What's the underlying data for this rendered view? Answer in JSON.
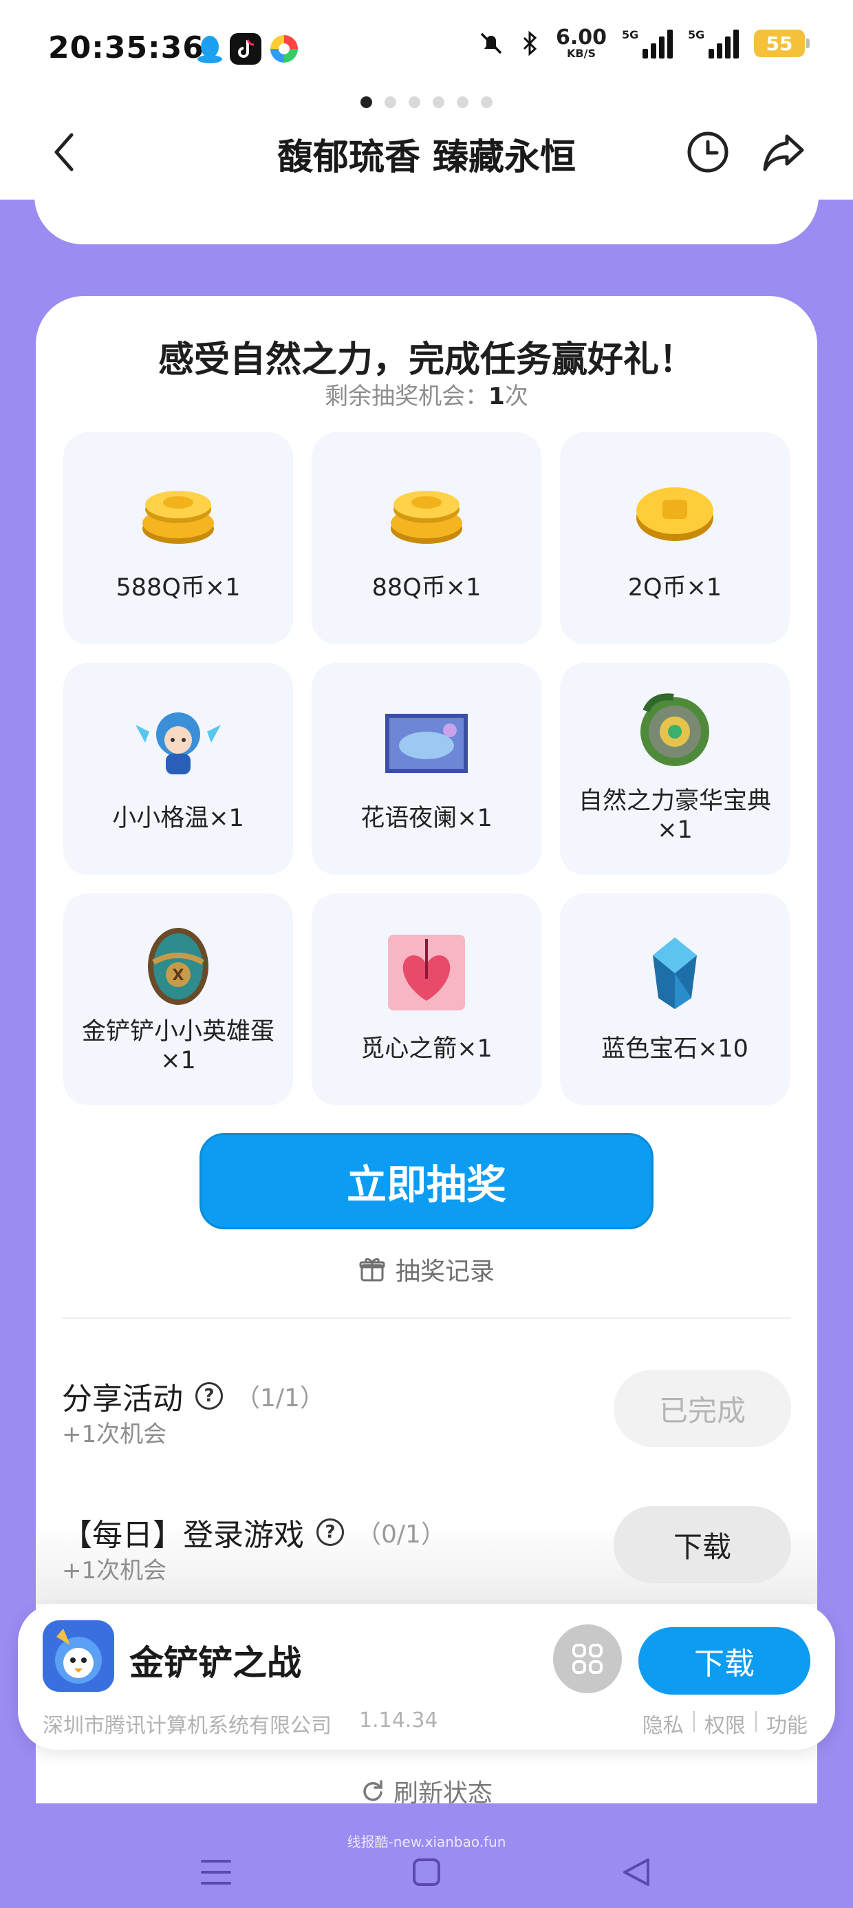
{
  "status_bar": {
    "time": "20:35:36",
    "net_speed_value": "6.00",
    "net_speed_unit": "KB/S",
    "sim1_label": "5G",
    "sim2_label": "5G",
    "battery": "55",
    "icons": [
      "qq-icon",
      "douyin-icon",
      "browser-icon",
      "mute-icon",
      "bluetooth-icon"
    ]
  },
  "header": {
    "title": "馥郁琉香 臻藏永恒",
    "icons": [
      "back-icon",
      "history-icon",
      "share-icon"
    ]
  },
  "carousel": {
    "count": 6,
    "active": 0
  },
  "promo": {
    "title": "感受自然之力，完成任务赢好礼！",
    "chances_label": "剩余抽奖机会：",
    "chances_value": "1",
    "chances_unit": "次"
  },
  "prizes": [
    {
      "name": "588Q币×1",
      "icon": "coin-stack-icon"
    },
    {
      "name": "88Q币×1",
      "icon": "coin-stack-icon"
    },
    {
      "name": "2Q币×1",
      "icon": "coin-icon"
    },
    {
      "name": "小小格温×1",
      "icon": "character-icon"
    },
    {
      "name": "花语夜阑×1",
      "icon": "arena-icon"
    },
    {
      "name": "自然之力豪华宝典×1",
      "icon": "pass-icon"
    },
    {
      "name": "金铲铲小小英雄蛋×1",
      "icon": "egg-icon"
    },
    {
      "name": "觅心之箭×1",
      "icon": "heart-arrow-icon"
    },
    {
      "name": "蓝色宝石×10",
      "icon": "gem-icon"
    }
  ],
  "draw_button": "立即抽奖",
  "record_link": "抽奖记录",
  "tasks": [
    {
      "title": "分享活动",
      "progress": "（1/1）",
      "reward": "+1次机会",
      "button": "已完成",
      "state": "done"
    },
    {
      "title": "【每日】登录游戏",
      "progress": "（0/1）",
      "reward": "+1次机会",
      "button": "下载",
      "state": "todo"
    }
  ],
  "refresh_label": "刷新状态",
  "app_bar": {
    "name": "金铲铲之战",
    "developer": "深圳市腾讯计算机系统有限公司",
    "version": "1.14.34",
    "download": "下载",
    "links": [
      "隐私",
      "权限",
      "功能"
    ]
  },
  "watermark": "线报酷-new.xianbao.fun",
  "colors": {
    "background": "#9b8cf2",
    "primary_button": "#0c9cf2",
    "tile": "#f3f6fc"
  }
}
